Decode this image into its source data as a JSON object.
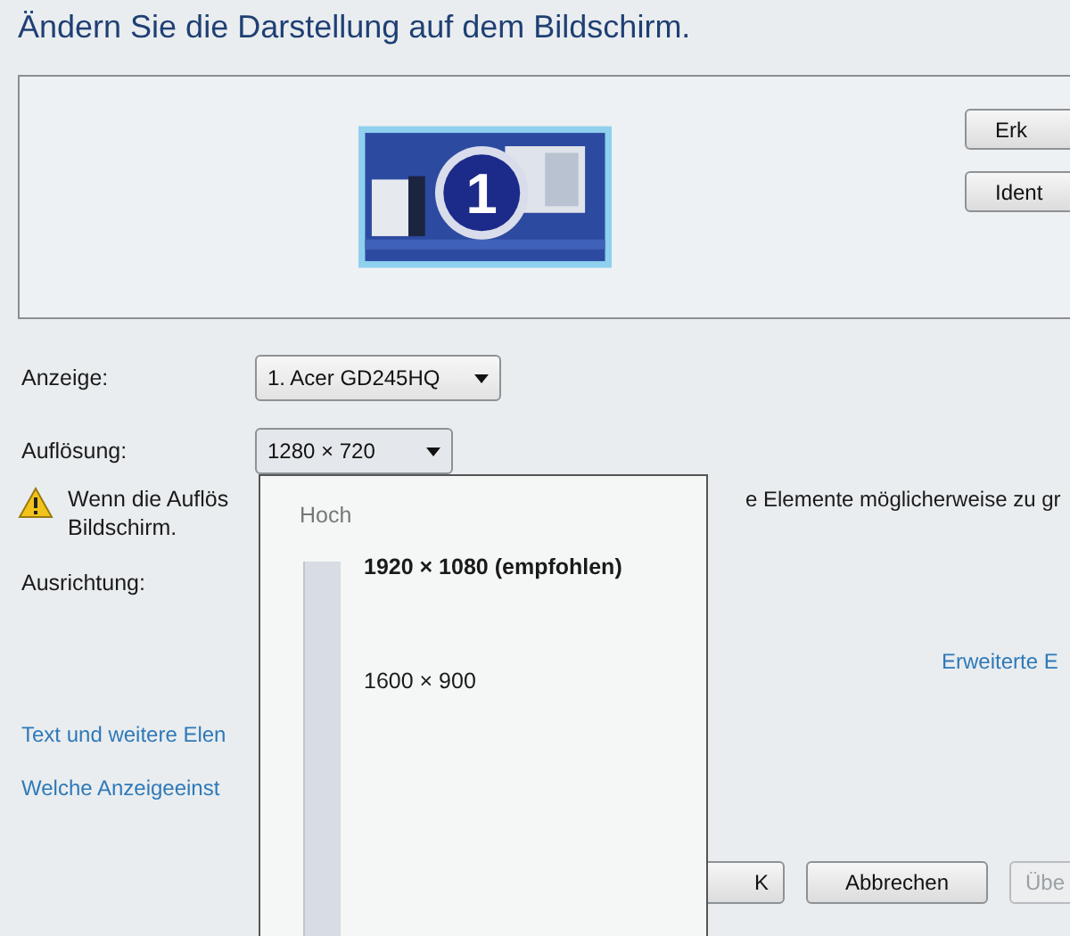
{
  "title": "Ändern Sie die Darstellung auf dem Bildschirm.",
  "preview": {
    "monitor_number": "1",
    "buttons": [
      {
        "label": "Erk"
      },
      {
        "label": "Ident"
      }
    ]
  },
  "display": {
    "label": "Anzeige:",
    "value": "1. Acer GD245HQ"
  },
  "resolution": {
    "label": "Auflösung:",
    "value": "1280 × 720",
    "expanded": true
  },
  "warning": {
    "left": "Wenn die Auflös",
    "right": "e Elemente möglicherweise zu gr",
    "line2": "Bildschirm."
  },
  "orientation": {
    "label": "Ausrichtung:"
  },
  "advanced_link": "Erweiterte E",
  "links": [
    "Text und weitere Elen",
    "Welche Anzeigeeinst"
  ],
  "buttons": [
    {
      "label": "K",
      "disabled": false
    },
    {
      "label": "Abbrechen",
      "disabled": false
    },
    {
      "label": "Übe",
      "disabled": true
    }
  ],
  "resolution_popup": {
    "top_label": "Hoch",
    "options": [
      {
        "label": "1920 × 1080 (empfohlen)",
        "selected": true
      },
      {
        "label": "1600 × 900",
        "selected": false
      }
    ]
  }
}
